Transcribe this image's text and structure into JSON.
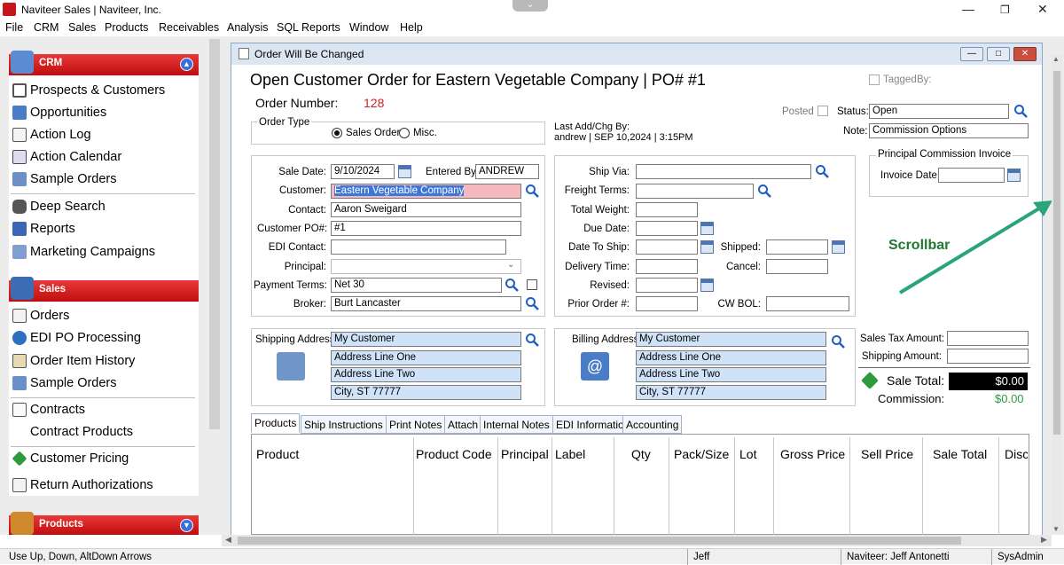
{
  "window": {
    "title": "Naviteer Sales | Naviteer, Inc."
  },
  "menubar": [
    "File",
    "CRM",
    "Sales",
    "Products",
    "Receivables",
    "Analysis",
    "SQL Reports",
    "Window",
    "Help"
  ],
  "sidebar": {
    "crm": {
      "header": "CRM",
      "items": [
        "Prospects & Customers",
        "Opportunities",
        "Action Log",
        "Action Calendar",
        "Sample Orders",
        "Deep Search",
        "Reports",
        "Marketing Campaigns"
      ]
    },
    "sales": {
      "header": "Sales",
      "items": [
        "Orders",
        "EDI PO Processing",
        "Order Item History",
        "Sample Orders",
        "Contracts",
        "Contract Products",
        "Customer Pricing",
        "Return Authorizations"
      ]
    },
    "products": {
      "header": "Products"
    }
  },
  "order_window": {
    "title": "Order Will Be Changed",
    "heading": "Open Customer Order for Eastern Vegetable Company | PO# #1",
    "order_number_label": "Order Number:",
    "order_number": "128",
    "order_type_label": "Order Type",
    "order_type_options": [
      "Sales Order",
      "Misc."
    ],
    "last_add_label": "Last Add/Chg By:",
    "last_add_value": "andrew | SEP 10,2024 |  3:15PM",
    "tagged_label": "Tagged",
    "by_label": "By:",
    "posted_label": "Posted",
    "status_label": "Status:",
    "status_value": "Open",
    "note_label": "Note:",
    "note_value": "Commission Options",
    "left_fields": {
      "sale_date_label": "Sale Date:",
      "sale_date": "9/10/2024",
      "entered_by_label": "Entered By:",
      "entered_by": "ANDREW",
      "customer_label": "Customer:",
      "customer": "Eastern Vegetable Company",
      "contact_label": "Contact:",
      "contact": "Aaron Sweigard",
      "customer_po_label": "Customer PO#:",
      "customer_po": "#1",
      "edi_contact_label": "EDI Contact:",
      "edi_contact": "",
      "principal_label": "Principal:",
      "principal": "",
      "payment_terms_label": "Payment Terms:",
      "payment_terms": "Net 30",
      "broker_label": "Broker:",
      "broker": "Burt Lancaster"
    },
    "right_fields": {
      "ship_via_label": "Ship Via:",
      "freight_terms_label": "Freight Terms:",
      "total_weight_label": "Total Weight:",
      "due_date_label": "Due Date:",
      "date_to_ship_label": "Date To Ship:",
      "shipped_label": "Shipped:",
      "delivery_time_label": "Delivery Time:",
      "cancel_label": "Cancel:",
      "revised_label": "Revised:",
      "prior_order_label": "Prior Order #:",
      "cw_bol_label": "CW BOL:"
    },
    "commission_invoice": {
      "title": "Principal Commission Invoice",
      "invoice_date_label": "Invoice Date:"
    },
    "annotation": "Scrollbar",
    "shipping": {
      "label": "Shipping Address:",
      "lines": [
        "My Customer",
        "Address Line One",
        "Address Line Two",
        "City, ST 77777"
      ]
    },
    "billing": {
      "label": "Billing Address:",
      "lines": [
        "My Customer",
        "Address Line One",
        "Address Line Two",
        "City, ST 77777"
      ]
    },
    "totals": {
      "sales_tax_label": "Sales Tax Amount:",
      "shipping_amount_label": "Shipping Amount:",
      "sale_total_label": "Sale Total:",
      "sale_total": "$0.00",
      "commission_label": "Commission:",
      "commission": "$0.00"
    },
    "tabs": [
      "Products",
      "Ship Instructions",
      "Print Notes",
      "Attach",
      "Internal Notes",
      "EDI Information",
      "Accounting"
    ],
    "columns": [
      "Product",
      "Product Code",
      "Principal",
      "Label",
      "Qty",
      "Pack/Size",
      "Lot",
      "Gross Price",
      "Sell Price",
      "Sale Total",
      "Disc"
    ]
  },
  "statusbar": {
    "hint": "Use Up, Down, AltDown Arrows",
    "user": "Jeff",
    "company_user": "Naviteer: Jeff Antonetti",
    "role": "SysAdmin"
  },
  "colors": {
    "accent_red": "#c00d0d",
    "field_blue": "#cfe2f7",
    "arrow_green": "#2aa57a",
    "commission_green": "#2e9a3c"
  }
}
